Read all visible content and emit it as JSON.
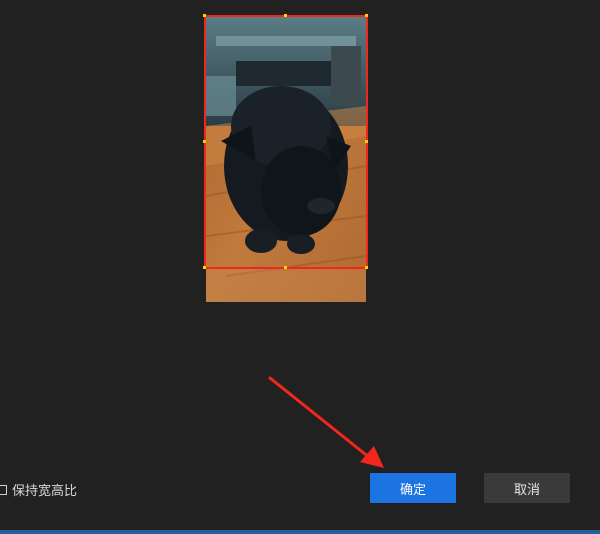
{
  "dialog": {
    "keep_aspect_label": "保持宽高比",
    "keep_aspect_checked": false,
    "confirm_label": "确定",
    "cancel_label": "取消"
  },
  "preview": {
    "image_subject": "black-cat-on-wooden-floor",
    "crop_border_color": "#f2261c"
  },
  "annotation": {
    "arrow_color": "#f2261c"
  },
  "colors": {
    "background": "#212121",
    "primary_button": "#1b74e2",
    "secondary_button": "#3a3a3a"
  }
}
